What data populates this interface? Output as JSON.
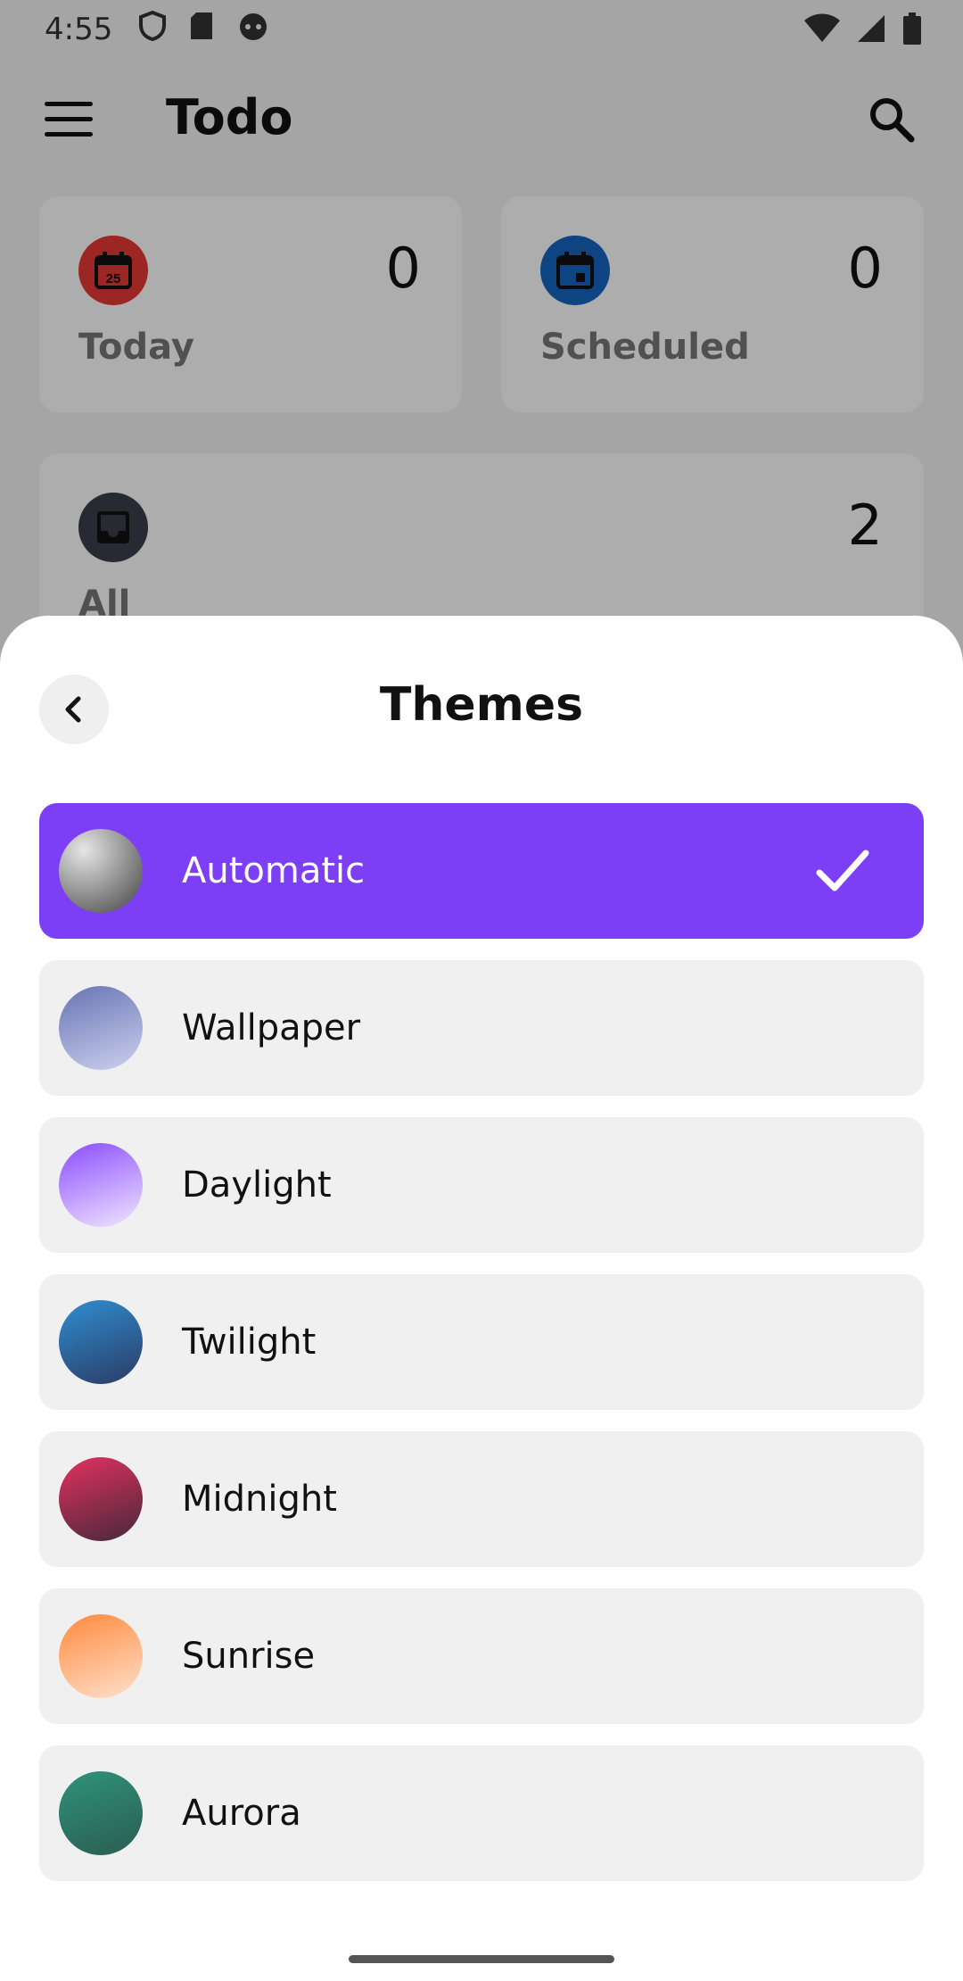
{
  "status_bar": {
    "time": "4:55"
  },
  "app_bar": {
    "title": "Todo"
  },
  "cards": {
    "today": {
      "label": "Today",
      "count": "0",
      "icon_day": "25",
      "color": "#e53935"
    },
    "scheduled": {
      "label": "Scheduled",
      "count": "0",
      "color": "#1565c0"
    },
    "all": {
      "label": "All",
      "count": "2",
      "color": "#3a3f4b"
    }
  },
  "sheet": {
    "title": "Themes",
    "themes": [
      {
        "label": "Automatic",
        "selected": true,
        "gradient": [
          "#d9d9d9",
          "#5a5a5a"
        ]
      },
      {
        "label": "Wallpaper",
        "selected": false,
        "gradient": [
          "#6f7ab8",
          "#c9cdeb"
        ]
      },
      {
        "label": "Daylight",
        "selected": false,
        "gradient": [
          "#8b4dff",
          "#efe1ff"
        ]
      },
      {
        "label": "Twilight",
        "selected": false,
        "gradient": [
          "#2f86c6",
          "#2b3f6b"
        ]
      },
      {
        "label": "Midnight",
        "selected": false,
        "gradient": [
          "#e0315e",
          "#4a2a38"
        ]
      },
      {
        "label": "Sunrise",
        "selected": false,
        "gradient": [
          "#ff8f45",
          "#ffd9c4"
        ]
      },
      {
        "label": "Aurora",
        "selected": false,
        "gradient": [
          "#2d8f78",
          "#2e5f52"
        ]
      }
    ],
    "accent_color": "#7c3ff5"
  }
}
